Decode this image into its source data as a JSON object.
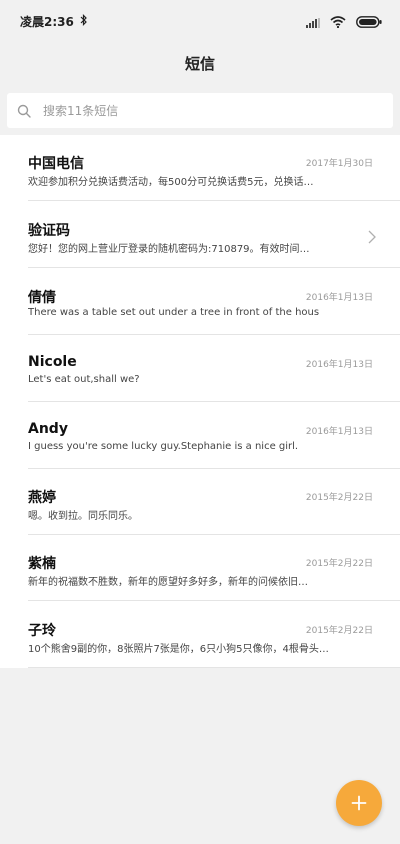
{
  "status_bar": {
    "time": "凌晨2:36",
    "icons": [
      "bluetooth-icon",
      "signal-icon",
      "wifi-icon",
      "battery-icon"
    ]
  },
  "header": {
    "title": "短信"
  },
  "search": {
    "placeholder": "搜索11条短信",
    "value": ""
  },
  "messages": [
    {
      "name": "中国电信",
      "date": "2017年1月30日",
      "preview": "欢迎参加积分兑换话费活动，每500分可兑换话费5元，兑换话…",
      "chevron": false
    },
    {
      "name": "验证码",
      "date": "",
      "preview": "您好！您的网上营业厅登录的随机密码为:710879。有效时间…",
      "chevron": true
    },
    {
      "name": "倩倩",
      "date": "2016年1月13日",
      "preview": "There was a table set out under a tree in front of the hous",
      "chevron": false
    },
    {
      "name": "Nicole",
      "date": "2016年1月13日",
      "preview": "Let's eat out,shall we?",
      "chevron": false
    },
    {
      "name": "Andy",
      "date": "2016年1月13日",
      "preview": "I guess you're some lucky guy.Stephanie is a nice girl.",
      "chevron": false
    },
    {
      "name": "燕婷",
      "date": "2015年2月22日",
      "preview": "嗯。收到拉。同乐同乐。",
      "chevron": false
    },
    {
      "name": "紫楠",
      "date": "2015年2月22日",
      "preview": "新年的祝福数不胜数，新年的愿望好多好多，新年的问候依旧…",
      "chevron": false
    },
    {
      "name": "子玲",
      "date": "2015年2月22日",
      "preview": "10个熊舍9副的你，8张照片7张是你，6只小狗5只像你，4根骨头3…",
      "chevron": false
    }
  ],
  "colors": {
    "accent": "#f6a93b",
    "background": "#f1f1f1",
    "divider": "#e4e4e4"
  },
  "fab": {
    "icon": "plus-icon"
  }
}
